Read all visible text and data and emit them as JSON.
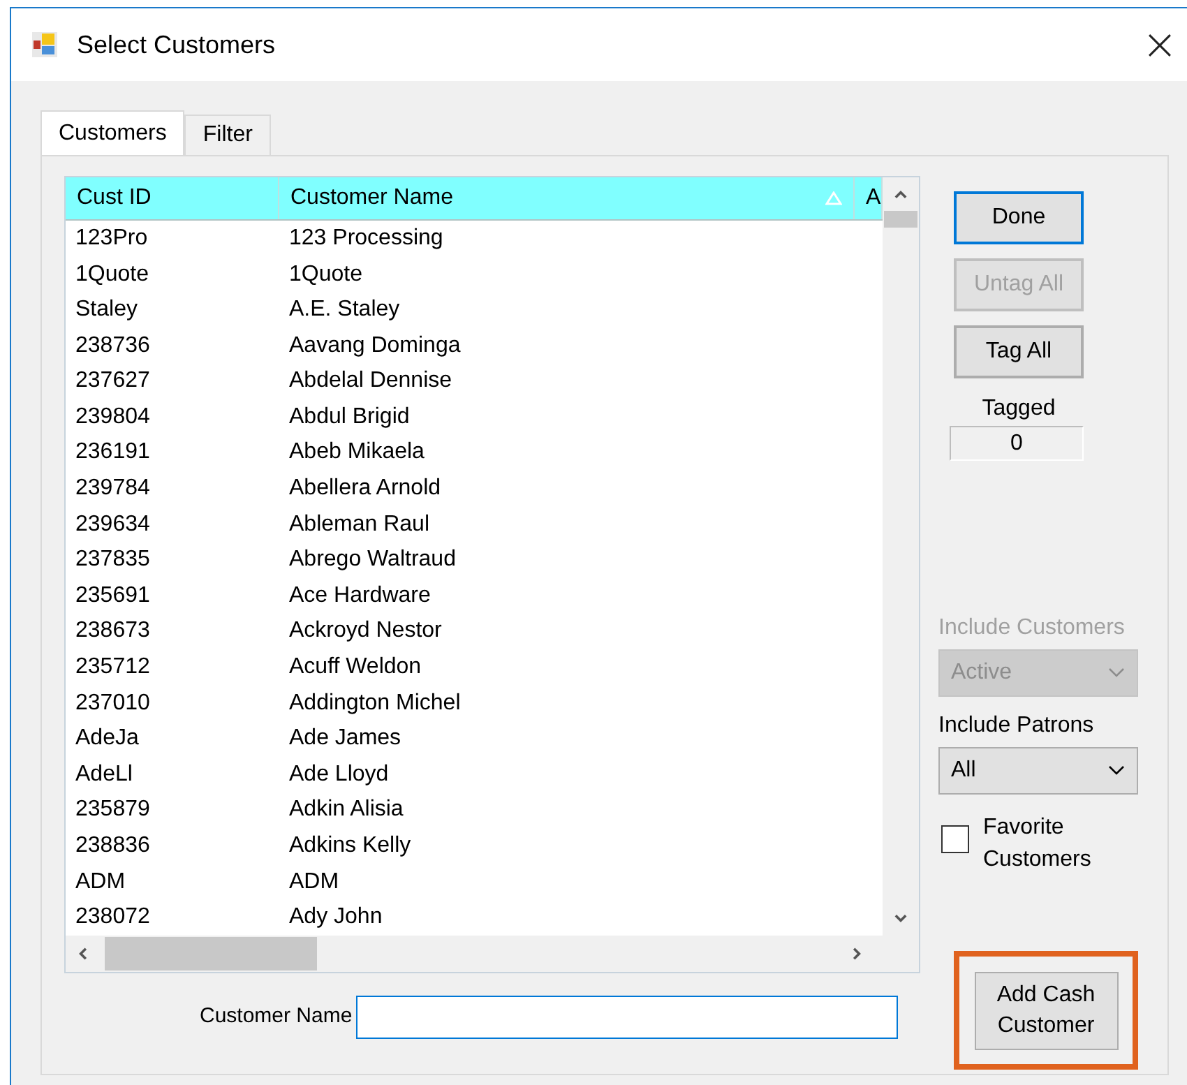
{
  "window": {
    "title": "Select Customers"
  },
  "tabs": [
    {
      "label": "Customers",
      "selected": true
    },
    {
      "label": "Filter",
      "selected": false
    }
  ],
  "table": {
    "columns": [
      {
        "label": "Cust ID",
        "sorted": false
      },
      {
        "label": "Customer Name",
        "sorted": true
      },
      {
        "label": "A",
        "sorted": false
      }
    ],
    "rows": [
      [
        "123Pro",
        "123 Processing"
      ],
      [
        "1Quote",
        "1Quote"
      ],
      [
        "Staley",
        "A.E. Staley"
      ],
      [
        "238736",
        "Aavang Dominga"
      ],
      [
        "237627",
        "Abdelal Dennise"
      ],
      [
        "239804",
        "Abdul Brigid"
      ],
      [
        "236191",
        "Abeb Mikaela"
      ],
      [
        "239784",
        "Abellera Arnold"
      ],
      [
        "239634",
        "Ableman Raul"
      ],
      [
        "237835",
        "Abrego Waltraud"
      ],
      [
        "235691",
        "Ace Hardware"
      ],
      [
        "238673",
        "Ackroyd Nestor"
      ],
      [
        "235712",
        "Acuff Weldon"
      ],
      [
        "237010",
        "Addington Michel"
      ],
      [
        "AdeJa",
        "Ade James"
      ],
      [
        "AdeLl",
        "Ade Lloyd"
      ],
      [
        "235879",
        "Adkin Alisia"
      ],
      [
        "238836",
        "Adkins Kelly"
      ],
      [
        "ADM",
        "ADM"
      ],
      [
        "238072",
        "Ady John"
      ]
    ]
  },
  "customer_name": {
    "label": "Customer Name"
  },
  "buttons": [
    {
      "label": "Done",
      "disabled": false,
      "focused": true
    },
    {
      "label": "Untag All",
      "disabled": true,
      "focused": false
    },
    {
      "label": "Tag All",
      "disabled": false,
      "focused": false
    }
  ],
  "tagged": {
    "label": "Tagged",
    "value": "0"
  },
  "include_customers": {
    "label": "Include Customers",
    "value": "Active",
    "disabled": true
  },
  "include_patrons": {
    "label": "Include Patrons",
    "value": "All",
    "disabled": false
  },
  "favorite_customers": {
    "label": "Favorite Customers",
    "checked": false
  },
  "add_cash_customer": {
    "label": "Add Cash Customer",
    "highlighted": true
  }
}
